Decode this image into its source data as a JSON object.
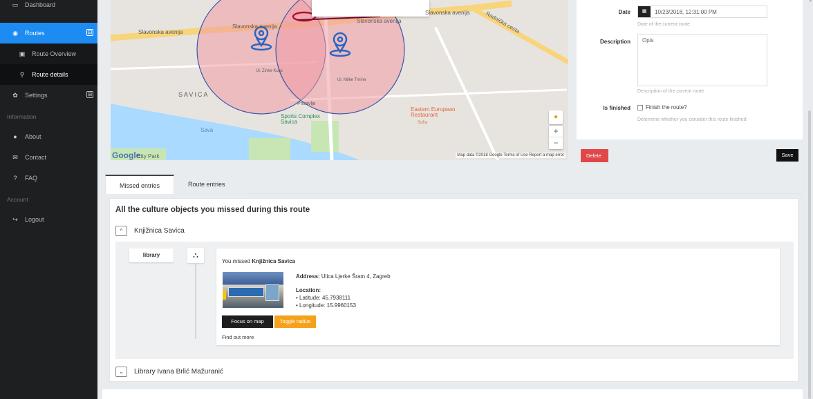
{
  "sidebar": {
    "items": [
      {
        "icon": "monitor-icon",
        "glyph": "▭",
        "label": "Dashboard"
      },
      {
        "icon": "route-icon",
        "glyph": "◉",
        "label": "Routes",
        "active": true,
        "toggle": "⊟"
      },
      {
        "icon": "image-icon",
        "glyph": "▣",
        "label": "Route Overview"
      },
      {
        "icon": "map-marker-icon",
        "glyph": "⚲",
        "label": "Route details"
      },
      {
        "icon": "gear-icon",
        "glyph": "✿",
        "label": "Settings",
        "toggle": "⊞"
      },
      {
        "icon": "info-icon",
        "glyph": "●",
        "label": "About"
      },
      {
        "icon": "envelope-icon",
        "glyph": "✉",
        "label": "Contact"
      },
      {
        "icon": "question-icon",
        "glyph": "?",
        "label": "FAQ"
      },
      {
        "icon": "logout-icon",
        "glyph": "↪",
        "label": "Logout"
      }
    ],
    "headers": {
      "information": "Information",
      "account": "Account"
    },
    "accent": "#1d8cf2"
  },
  "map": {
    "labels": {
      "road1": "Slavonska avenija",
      "road2": "Slavonska avenija",
      "road3": "Slavonska avenija",
      "road4": "Slavonska avenija",
      "road5": "Radnička cesta",
      "area": "SAVICA",
      "river": "Sava",
      "sports": "Sports Complex Savica",
      "restaurant": "Eastern European Restaurant",
      "restaurant_sub": "Sofra",
      "street1": "Ul. Zinke Kunc",
      "street2": "Ul. Milke Trnine",
      "street3": "Prisavlje"
    },
    "google": "Google",
    "city_park": "City Park",
    "footer": "Map data ©2018 Google   Terms of Use   Report a map error",
    "zoom_in": "+",
    "zoom_out": "−",
    "pegman_icon": "pegman-icon",
    "circle_color": "#e3394c",
    "circle_edge": "#3a55a8"
  },
  "form": {
    "date_label": "Date",
    "date_value": "10/23/2018, 12:31:00 PM",
    "date_help": "Date of the current route",
    "desc_label": "Description",
    "desc_value": "Opis",
    "desc_help": "Description of the current route",
    "finished_label": "Is finished",
    "finished_checkbox": "Finish the route?",
    "finished_help": "Determine whether you consider this route finished",
    "delete": "Delete",
    "save": "Save"
  },
  "tabs": [
    {
      "label": "Missed entries",
      "active": true
    },
    {
      "label": "Route entries",
      "active": false
    }
  ],
  "content": {
    "title": "All the culture objects you missed during this route",
    "accordions": [
      {
        "name": "Knjižnica Savica",
        "expanded": true,
        "toggle": "^"
      },
      {
        "name": "Library Ivana Brlić Mažuranić",
        "expanded": false,
        "toggle": "⌄"
      }
    ],
    "entry": {
      "category": "library",
      "category_icon": "library-icon",
      "missed_prefix": "You missed",
      "missed_name": "Knjižnica Savica",
      "address_label": "Address:",
      "address_value": "Ulica Ljerke Šram 4, Zagreb",
      "location_label": "Location:",
      "latitude": "Latitude: 45.7938111",
      "longitude": "Longitude: 15.9960153",
      "focus_button": "Focus on map",
      "radius_button": "Toggle radius",
      "more_link": "Find out more"
    }
  }
}
